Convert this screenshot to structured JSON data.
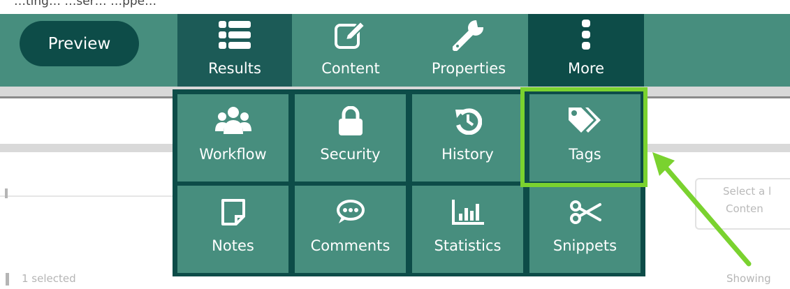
{
  "caption": "…ting… …ser… …ppe…",
  "toolbar": {
    "preview_label": "Preview",
    "buttons": [
      {
        "label": "Results",
        "icon": "list-icon"
      },
      {
        "label": "Content",
        "icon": "edit-icon"
      },
      {
        "label": "Properties",
        "icon": "wrench-icon"
      },
      {
        "label": "More",
        "icon": "kebab-icon"
      }
    ]
  },
  "menu": {
    "items": [
      {
        "label": "Workflow",
        "icon": "users-icon"
      },
      {
        "label": "Security",
        "icon": "lock-icon"
      },
      {
        "label": "History",
        "icon": "history-icon"
      },
      {
        "label": "Tags",
        "icon": "tags-icon",
        "highlighted": true
      },
      {
        "label": "Notes",
        "icon": "note-icon"
      },
      {
        "label": "Comments",
        "icon": "comment-icon"
      },
      {
        "label": "Statistics",
        "icon": "statistics-icon"
      },
      {
        "label": "Snippets",
        "icon": "scissors-icon"
      }
    ]
  },
  "background": {
    "select_line1": "Select a l",
    "select_line2": "Conten",
    "selected_text": "1 selected",
    "showing_text": "Showing"
  },
  "colors": {
    "toolbar": "#478e7e",
    "dark": "#0d4c48",
    "active": "#1c5b57",
    "highlight": "#7ad22f"
  }
}
